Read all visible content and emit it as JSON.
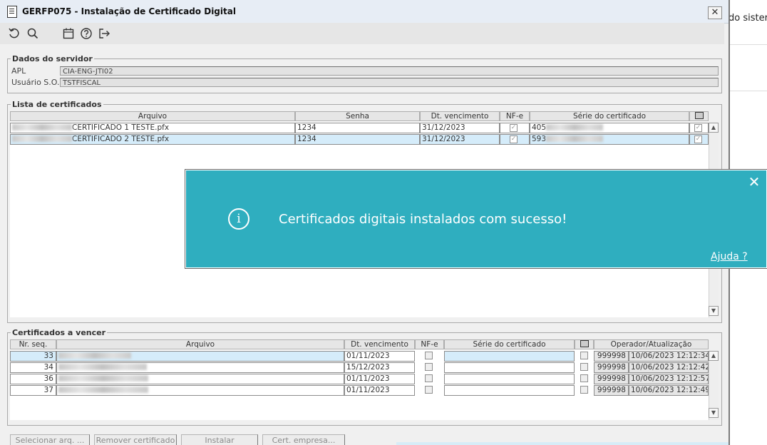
{
  "window": {
    "title": "GERFP075 - Instalação de Certificado Digital",
    "close_glyph": "✕"
  },
  "toolbar": {
    "icons": [
      "refresh-icon",
      "search-icon",
      "calendar-icon",
      "help-icon",
      "exit-icon"
    ]
  },
  "server": {
    "legend": "Dados do servidor",
    "apl_label": "APL",
    "apl_value": "CIA-ENG-JTI02",
    "user_label": "Usuário S.O.",
    "user_value": "TSTFISCAL"
  },
  "cert_list": {
    "legend": "Lista de certificados",
    "headers": {
      "arquivo": "Arquivo",
      "senha": "Senha",
      "vencimento": "Dt. vencimento",
      "nfe": "NF-e",
      "serie": "Série do certificado"
    },
    "rows": [
      {
        "arquivo": "CERTIFICADO 1 TESTE.pfx",
        "senha": "1234",
        "vencimento": "31/12/2023",
        "nfe": true,
        "serie": "405",
        "checked": true,
        "selected": false
      },
      {
        "arquivo": "CERTIFICADO 2 TESTE.pfx",
        "senha": "1234",
        "vencimento": "31/12/2023",
        "nfe": true,
        "serie": "593",
        "checked": true,
        "selected": true
      }
    ]
  },
  "expiring": {
    "legend": "Certificados a vencer",
    "headers": {
      "seq": "Nr. seq.",
      "arquivo": "Arquivo",
      "vencimento": "Dt. vencimento",
      "nfe": "NF-e",
      "serie": "Série do certificado",
      "operador": "Operador/Atualização"
    },
    "rows": [
      {
        "seq": "33",
        "vencimento": "01/11/2023",
        "operador": "999998",
        "atualizacao": "10/06/2023 12:12:34",
        "selected": true
      },
      {
        "seq": "34",
        "vencimento": "15/12/2023",
        "operador": "999998",
        "atualizacao": "10/06/2023 12:12:42",
        "selected": false
      },
      {
        "seq": "36",
        "vencimento": "01/11/2023",
        "operador": "999998",
        "atualizacao": "10/06/2023 12:12:57",
        "selected": false
      },
      {
        "seq": "37",
        "vencimento": "01/11/2023",
        "operador": "999998",
        "atualizacao": "10/06/2023 12:12:49",
        "selected": false
      }
    ]
  },
  "buttons": {
    "select_file": "Selecionar arq. ...",
    "remove_cert": "Remover certificado",
    "install": "Instalar",
    "cert_company": "Cert. empresa..."
  },
  "toast": {
    "message": "Certificados digitais instalados com sucesso!",
    "help": "Ajuda ?",
    "close_glyph": "✕",
    "info_glyph": "i",
    "color": "#2faebf"
  },
  "background": {
    "partial_text": "do sister"
  }
}
